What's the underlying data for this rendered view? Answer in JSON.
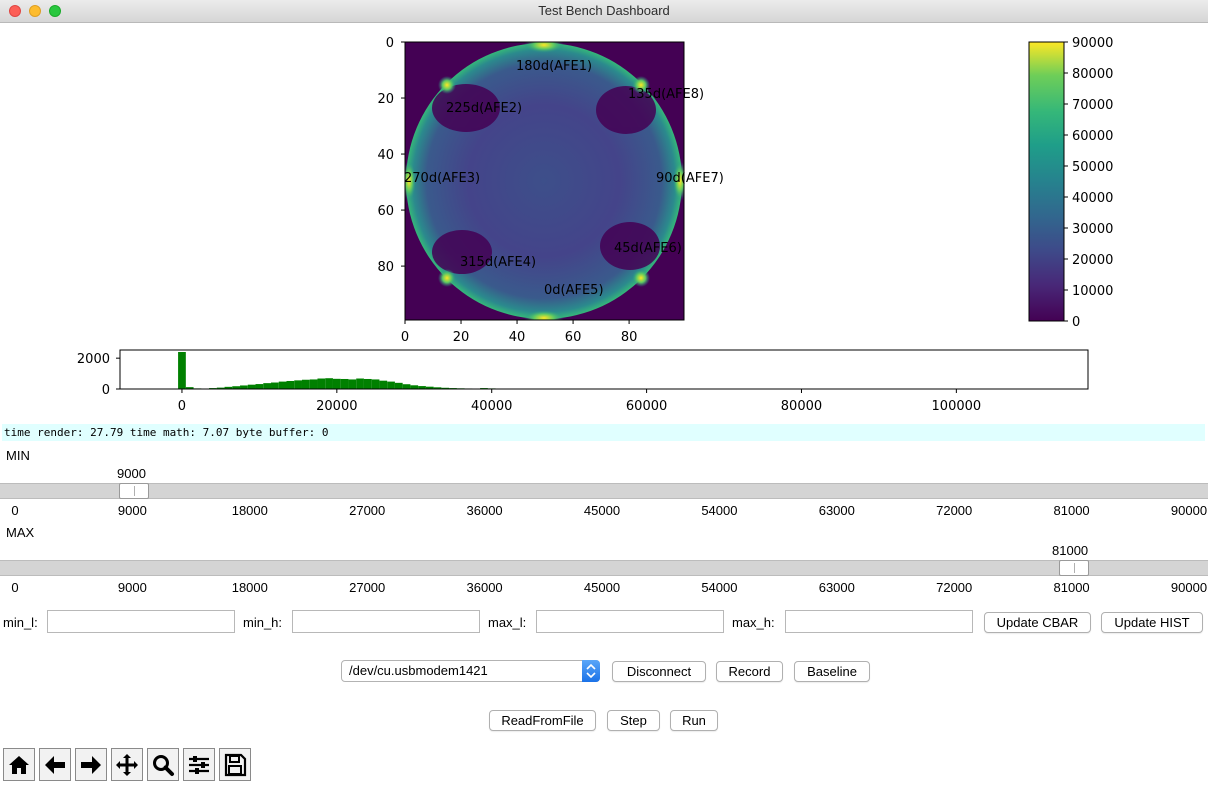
{
  "window": {
    "title": "Test Bench Dashboard"
  },
  "heatmap": {
    "x_ticks": [
      "0",
      "20",
      "40",
      "60",
      "80"
    ],
    "y_ticks": [
      "0",
      "20",
      "40",
      "60",
      "80"
    ],
    "annotations": [
      "180d(AFE1)",
      "135d(AFE8)",
      "225d(AFE2)",
      "270d(AFE3)",
      "90d(AFE7)",
      "45d(AFE6)",
      "315d(AFE4)",
      "0d(AFE5)"
    ],
    "colormap": "viridis",
    "background_color": "#440154"
  },
  "colorbar": {
    "ticks": [
      "90000",
      "80000",
      "70000",
      "60000",
      "50000",
      "40000",
      "30000",
      "20000",
      "10000",
      "0"
    ]
  },
  "chart_data": {
    "type": "bar",
    "x": [
      0,
      1000,
      2000,
      3000,
      4000,
      5000,
      6000,
      7000,
      8000,
      9000,
      10000,
      11000,
      12000,
      13000,
      14000,
      15000,
      16000,
      17000,
      18000,
      19000,
      20000,
      21000,
      22000,
      23000,
      24000,
      25000,
      26000,
      27000,
      28000,
      29000,
      30000,
      31000,
      32000,
      33000,
      34000,
      35000,
      36000,
      37000,
      38000,
      39000,
      40000,
      41000
    ],
    "values": [
      2400,
      120,
      40,
      30,
      60,
      90,
      140,
      180,
      230,
      280,
      320,
      380,
      420,
      480,
      520,
      560,
      600,
      620,
      680,
      700,
      660,
      650,
      620,
      680,
      650,
      620,
      540,
      480,
      400,
      310,
      240,
      190,
      150,
      110,
      80,
      60,
      45,
      35,
      25,
      60,
      40,
      15
    ],
    "bar_color": "#008000",
    "xticks": [
      "0",
      "20000",
      "40000",
      "60000",
      "80000",
      "100000"
    ],
    "yticks": [
      "0",
      "2000"
    ],
    "xlim": [
      -8000,
      117000
    ],
    "ylim": [
      0,
      2400
    ]
  },
  "status": {
    "text": "time render: 27.79 time math: 7.07 byte buffer: 0"
  },
  "min_slider": {
    "label": "MIN",
    "value": "9000",
    "fraction": 0.1,
    "ticks": [
      "0",
      "9000",
      "18000",
      "27000",
      "36000",
      "45000",
      "54000",
      "63000",
      "72000",
      "81000",
      "90000"
    ]
  },
  "max_slider": {
    "label": "MAX",
    "value": "81000",
    "fraction": 0.9,
    "ticks": [
      "0",
      "9000",
      "18000",
      "27000",
      "36000",
      "45000",
      "54000",
      "63000",
      "72000",
      "81000",
      "90000"
    ]
  },
  "fields": {
    "min_l": {
      "label": "min_l:",
      "value": ""
    },
    "min_h": {
      "label": "min_h:",
      "value": ""
    },
    "max_l": {
      "label": "max_l:",
      "value": ""
    },
    "max_h": {
      "label": "max_h:",
      "value": ""
    }
  },
  "buttons": {
    "update_cbar": "Update CBAR",
    "update_hist": "Update HIST",
    "disconnect": "Disconnect",
    "record": "Record",
    "baseline": "Baseline",
    "read_from_file": "ReadFromFile",
    "step": "Step",
    "run": "Run"
  },
  "port_select": {
    "value": "/dev/cu.usbmodem1421"
  },
  "toolbar": {
    "icons": [
      "home-icon",
      "back-arrow-icon",
      "forward-arrow-icon",
      "pan-icon",
      "zoom-icon",
      "configure-icon",
      "save-icon"
    ]
  }
}
